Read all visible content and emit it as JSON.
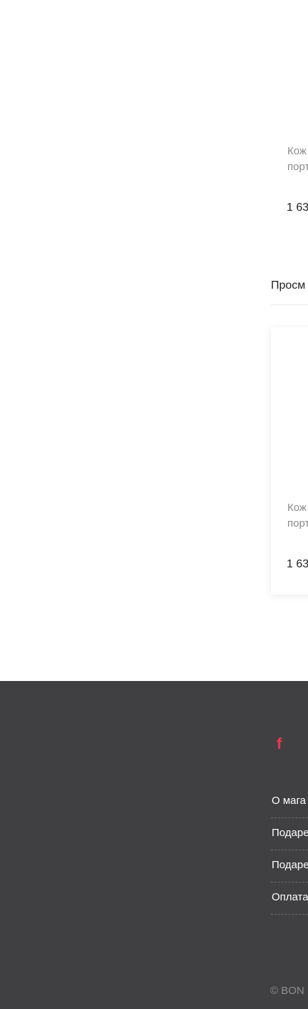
{
  "product_top": {
    "name_line1": "Кож",
    "name_line2": "порт",
    "price": "1 63"
  },
  "recently_viewed": {
    "title": "Просм",
    "product": {
      "name_line1": "Кож",
      "name_line2": "порт",
      "price": "1 63"
    }
  },
  "footer": {
    "social_icon": "facebook-icon",
    "links": [
      "О мага",
      "Подаре",
      "Подаре",
      "Оплата"
    ],
    "copyright": "© BON"
  },
  "colors": {
    "footer_bg": "#404042",
    "accent": "#e8384f"
  }
}
